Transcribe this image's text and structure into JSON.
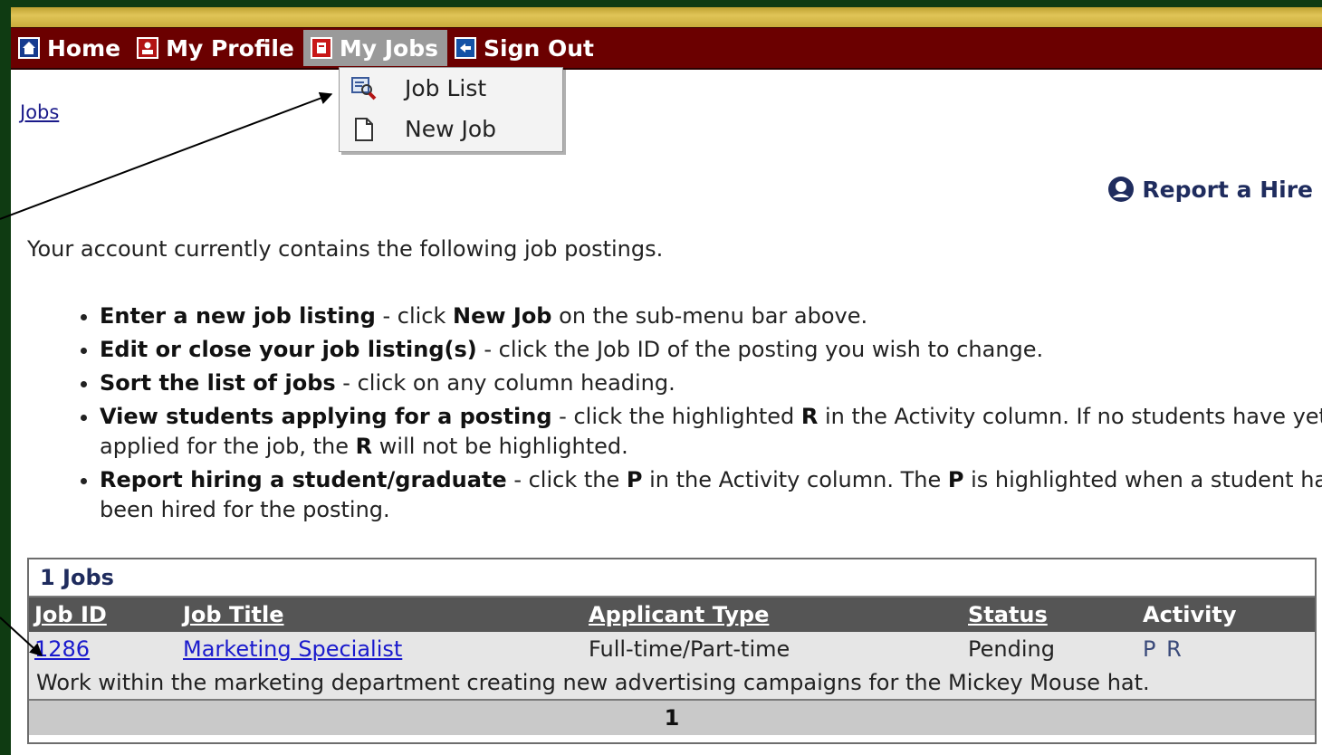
{
  "menu": {
    "home": "Home",
    "profile": "My Profile",
    "jobs": "My Jobs",
    "signout": "Sign Out"
  },
  "dropdown": {
    "job_list": "Job List",
    "new_job": "New Job"
  },
  "breadcrumb": "Jobs",
  "report_hire": "Report a Hire",
  "intro": "Your account currently contains the following job postings.",
  "bullets": [
    {
      "bold": "Enter a new job listing",
      "text1": " - click ",
      "bold2": "New Job",
      "text2": " on the sub-menu bar above."
    },
    {
      "bold": "Edit or close your job listing(s)",
      "text1": " - click the Job ID of the posting you wish to change."
    },
    {
      "bold": "Sort the list of jobs",
      "text1": " - click on any column heading."
    },
    {
      "bold": "View students applying for a posting",
      "text1": " - click the highlighted ",
      "bold2": "R",
      "text2": " in the Activity column. If no students have yet applied for the job, the ",
      "bold3": "R",
      "text3": " will not be highlighted."
    },
    {
      "bold": "Report hiring a student/graduate",
      "text1": " - click the ",
      "bold2": "P",
      "text2": " in the Activity column. The ",
      "bold3": "P",
      "text3": " is highlighted when a student has been hired for the posting."
    }
  ],
  "table": {
    "count_label": "1 Jobs",
    "columns": {
      "job_id": "Job ID",
      "job_title": "Job Title",
      "applicant_type": "Applicant Type",
      "status": "Status",
      "activity": "Activity"
    },
    "rows": [
      {
        "job_id": "1286",
        "job_title": "Marketing Specialist",
        "applicant_type": "Full-time/Part-time",
        "status": "Pending",
        "activity": "P R",
        "description": "Work within the marketing department creating new advertising campaigns for the Mickey Mouse hat."
      }
    ],
    "page": "1"
  },
  "colors": {
    "menubar": "#6b0000",
    "goldbar": "#d4b84a",
    "outer_frame": "#0f3b12",
    "table_header": "#555555",
    "link": "#1a1acd"
  },
  "icons": [
    "home-icon",
    "profile-icon",
    "jobs-icon",
    "signout-icon",
    "job-list-icon",
    "new-job-icon",
    "report-hire-icon"
  ]
}
